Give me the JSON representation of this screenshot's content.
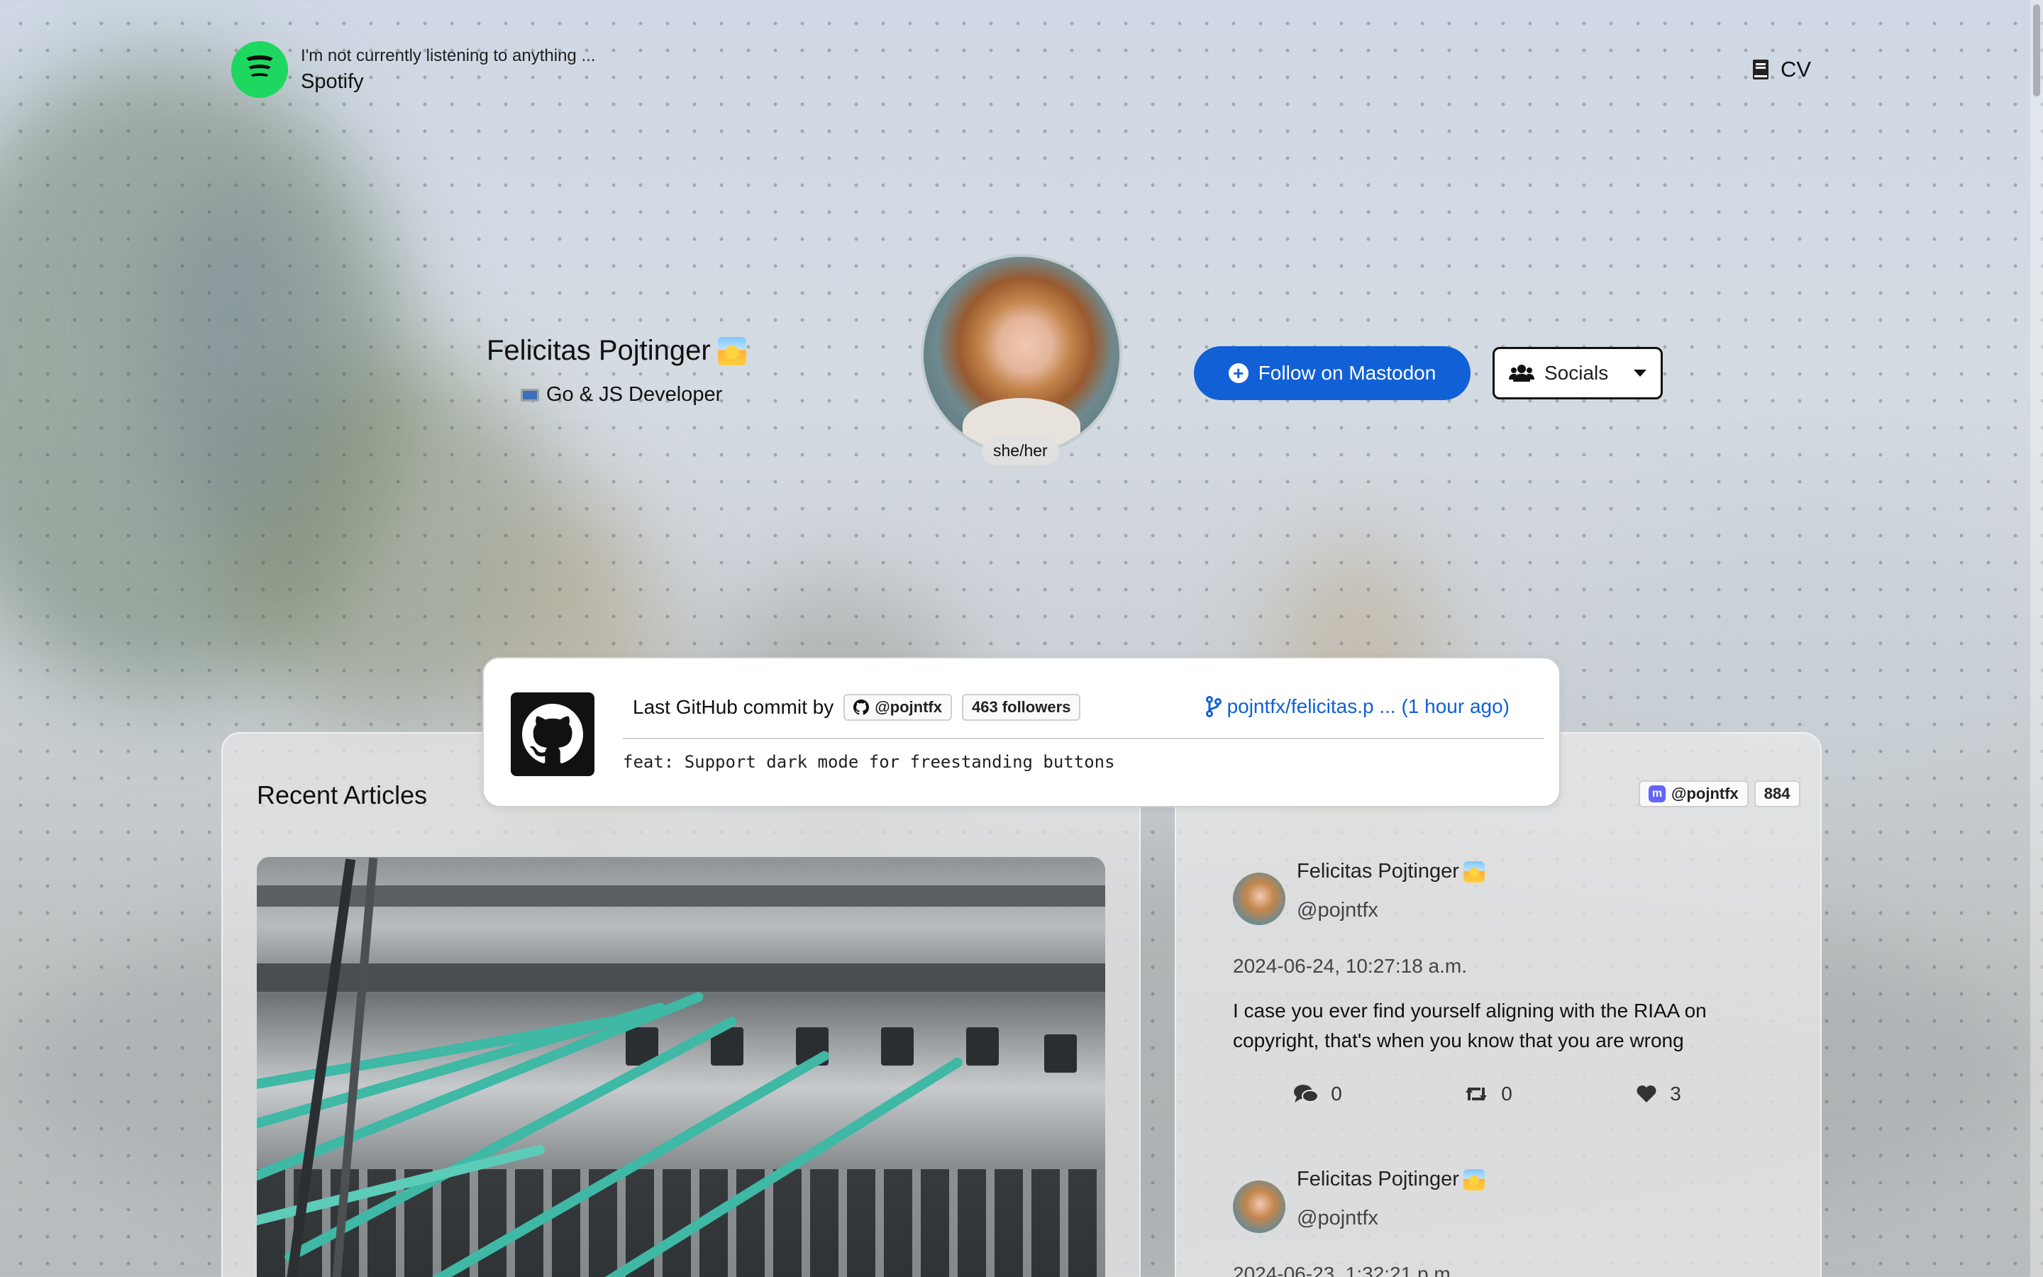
{
  "spotify": {
    "status": "I'm not currently listening to anything ...",
    "label": "Spotify"
  },
  "nav": {
    "cv_label": "CV"
  },
  "profile": {
    "name": "Felicitas Pojtinger",
    "role": "Go & JS Developer",
    "pronouns": "she/her"
  },
  "actions": {
    "follow_label": "Follow on Mastodon",
    "socials_label": "Socials"
  },
  "github": {
    "title": "Last GitHub commit by",
    "username": "@pojntfx",
    "followers": "463 followers",
    "repo": "pojntfx/felicitas.p ... (1 hour ago)",
    "commit_message": "feat: Support dark mode for freestanding buttons"
  },
  "articles": {
    "title": "Recent Articles"
  },
  "mastodon": {
    "handle": "@pojntfx",
    "count": "884",
    "posts": [
      {
        "name": "Felicitas Pojtinger",
        "handle": "@pojntfx",
        "date": "2024-06-24, 10:27:18 a.m.",
        "text_line1": "I case you ever find yourself aligning with the RIAA on",
        "text_line2": "copyright, that's when you know that you are wrong",
        "replies": "0",
        "boosts": "0",
        "likes": "3"
      },
      {
        "name": "Felicitas Pojtinger",
        "handle": "@pojntfx",
        "date": "2024-06-23, 1:32:21 p.m."
      }
    ]
  },
  "colors": {
    "spotify_green": "#1ed760",
    "mastodon_blue": "#1160d6",
    "mastodon_purple": "#6364ff"
  }
}
